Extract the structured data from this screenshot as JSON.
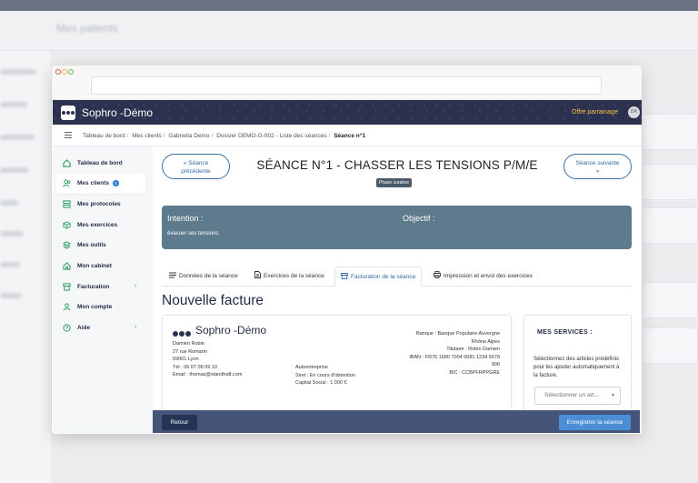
{
  "background_app": {
    "breadcrumb": "Mes patients"
  },
  "header": {
    "brand": "Sophro -Démo",
    "offer_link": "Offre parrainage",
    "avatar_initials": "DR"
  },
  "breadcrumb": {
    "items": [
      "Tableau de bord",
      "Mes clients",
      "Gabriella Demo",
      "Dossier DEMO-G-002 - Liste des séances"
    ],
    "current": "Séance n°1"
  },
  "sidebar": {
    "items": [
      {
        "label": "Tableau de bord",
        "icon": "home-icon"
      },
      {
        "label": "Mes clients",
        "icon": "users-icon",
        "badge": "5",
        "active": true
      },
      {
        "label": "Mes protocoles",
        "icon": "layers-icon"
      },
      {
        "label": "Mes exercices",
        "icon": "cube-icon"
      },
      {
        "label": "Mes outils",
        "icon": "stack-icon"
      },
      {
        "label": "Mon cabinet",
        "icon": "building-icon"
      },
      {
        "label": "Facturation",
        "icon": "archive-icon",
        "chevron": "›"
      },
      {
        "label": "Mon compte",
        "icon": "user-icon"
      },
      {
        "label": "Aide",
        "icon": "help-icon",
        "chevron": "›"
      }
    ]
  },
  "seance": {
    "prev_label_1": "« Séance",
    "prev_label_2": "précédente",
    "title": "SÉANCE N°1 - CHASSER LES TENSIONS P/M/E",
    "next_label_1": "Séance suivante",
    "next_label_2": "»",
    "phase": "Phase curative",
    "intention_label": "Intention :",
    "objectif_label": "Objectif :",
    "intention_text": "évacuer ses tensions"
  },
  "tabs": [
    {
      "label": "Données de la séance",
      "icon": "list-icon"
    },
    {
      "label": "Exercices de la séance",
      "icon": "document-icon"
    },
    {
      "label": "Facturation de la séance",
      "icon": "archive-icon",
      "active": true
    },
    {
      "label": "Impression et envoi des exercices",
      "icon": "printer-icon"
    }
  ],
  "invoice": {
    "page_title": "Nouvelle facture",
    "brand": "Sophro -Démo",
    "left_lines": [
      "Damien Robin",
      "27 rue Romarin",
      "69001 Lyon",
      "Tél : 06 07 08 09 10",
      "Email : thomas@standhaft.com"
    ],
    "mid_lines": [
      "Autoentreprise",
      "Siret : En cours d'obtention",
      "Capital Social : 1 000 €"
    ],
    "right_lines": [
      "Banque : Banque Populaire Auvergne",
      "Rhône Alpes",
      "Titulaire : Robin Damien",
      "IBAN : FR76 1680 7004 0081 1234 5678",
      "900",
      "BIC : CCBPFRPPGRE"
    ]
  },
  "services": {
    "title": "MES SERVICES :",
    "description": "Sélectionnez des articles prédéfinis pour les ajouter automatiquement à la facture.",
    "select_placeholder": "Sélectionner un art..."
  },
  "footer": {
    "back_label": "Retour",
    "save_label": "Enregistrer la séance"
  },
  "colors": {
    "header_bg": "#2c3150",
    "accent": "#2d6aa8",
    "intent_bg": "#5e7b8d",
    "footer_bg": "#45557a",
    "save_bg": "#4b8ed6",
    "offer": "#f6c244"
  }
}
